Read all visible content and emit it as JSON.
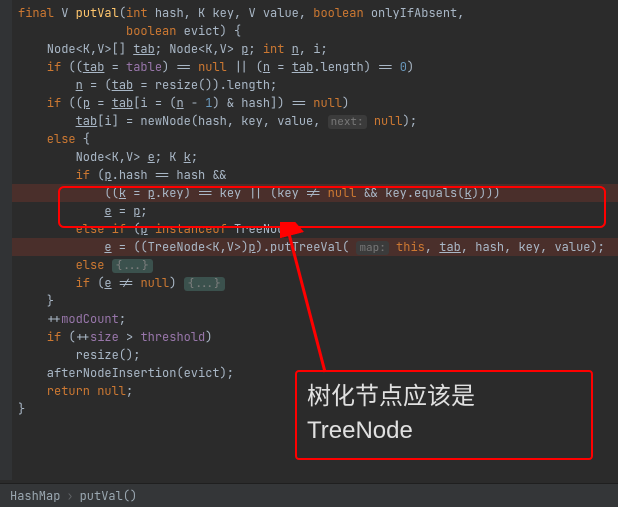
{
  "code": {
    "l1_a": "final",
    "l1_b": " V ",
    "l1_c": "putVal",
    "l1_d": "(",
    "l1_e": "int",
    "l1_f": " hash, K key, V value, ",
    "l1_g": "boolean",
    "l1_h": " onlyIfAbsent,",
    "l2_a": "               ",
    "l2_b": "boolean",
    "l2_c": " evict) {",
    "l3_a": "    Node<K,V>[] ",
    "l3_b": "tab",
    "l3_c": "; Node<K,V> ",
    "l3_d": "p",
    "l3_e": "; ",
    "l3_f": "int",
    "l3_g": " ",
    "l3_h": "n",
    "l3_i": ", i;",
    "l4_a": "    if",
    "l4_b": " ((",
    "l4_c": "tab",
    "l4_d": " = ",
    "l4_e": "table",
    "l4_f": ") == ",
    "l4_g": "null",
    "l4_h": " || (",
    "l4_i": "n",
    "l4_j": " = ",
    "l4_k": "tab",
    "l4_l": ".length) == ",
    "l4_m": "0",
    "l4_n": ")",
    "l5_a": "        ",
    "l5_b": "n",
    "l5_c": " = (",
    "l5_d": "tab",
    "l5_e": " = resize()).length;",
    "l6_a": "    if",
    "l6_b": " ((",
    "l6_c": "p",
    "l6_d": " = ",
    "l6_e": "tab",
    "l6_f": "[i = (",
    "l6_g": "n",
    "l6_h": " - ",
    "l6_i": "1",
    "l6_j": ") & hash]) == ",
    "l6_k": "null",
    "l6_l": ")",
    "l7_a": "        ",
    "l7_b": "tab",
    "l7_c": "[i] = newNode(hash, key, value, ",
    "l7_hint": "next:",
    "l7_d": " ",
    "l7_e": "null",
    "l7_f": ");",
    "l8_a": "    else",
    "l8_b": " {",
    "l9_a": "        Node<K,V> ",
    "l9_b": "e",
    "l9_c": "; K ",
    "l9_d": "k",
    "l9_e": ";",
    "l10_a": "        if",
    "l10_b": " (",
    "l10_c": "p",
    "l10_d": ".hash == hash &&",
    "l11_a": "            ((",
    "l11_b": "k",
    "l11_c": " = ",
    "l11_d": "p",
    "l11_e": ".key) == key || (key != ",
    "l11_f": "null",
    "l11_g": " && key.equals(",
    "l11_h": "k",
    "l11_i": "))))",
    "l12_a": "            ",
    "l12_b": "e",
    "l12_c": " = ",
    "l12_d": "p",
    "l12_e": ";",
    "l13_a": "        else if",
    "l13_b": " (",
    "l13_c": "p",
    "l13_d": " ",
    "l13_e": "instanceof",
    "l13_f": " TreeNode)",
    "l14_a": "            ",
    "l14_b": "e",
    "l14_c": " = ((TreeNode<K,V>)",
    "l14_d": "p",
    "l14_e": ").putTreeVal( ",
    "l14_hint": "map:",
    "l14_f": " ",
    "l14_g": "this",
    "l14_h": ", ",
    "l14_i": "tab",
    "l14_j": ", hash, key, value);",
    "l15_a": "        else",
    "l15_b": " ",
    "l15_fold": "{...}",
    "l16_a": "        if",
    "l16_b": " (",
    "l16_c": "e",
    "l16_d": " != ",
    "l16_e": "null",
    "l16_f": ") ",
    "l16_fold": "{...}",
    "l17": "    }",
    "l18_a": "    ++",
    "l18_b": "modCount",
    "l18_c": ";",
    "l19_a": "    if",
    "l19_b": " (++",
    "l19_c": "size",
    "l19_d": " > ",
    "l19_e": "threshold",
    "l19_f": ")",
    "l20": "        resize();",
    "l21": "    afterNodeInsertion(evict);",
    "l22_a": "    return null",
    "l22_b": ";",
    "l23": "}"
  },
  "callout": {
    "line1": "树化节点应该是",
    "line2": "TreeNode"
  },
  "breadcrumb": {
    "c1": "HashMap",
    "c2": "putVal()"
  }
}
